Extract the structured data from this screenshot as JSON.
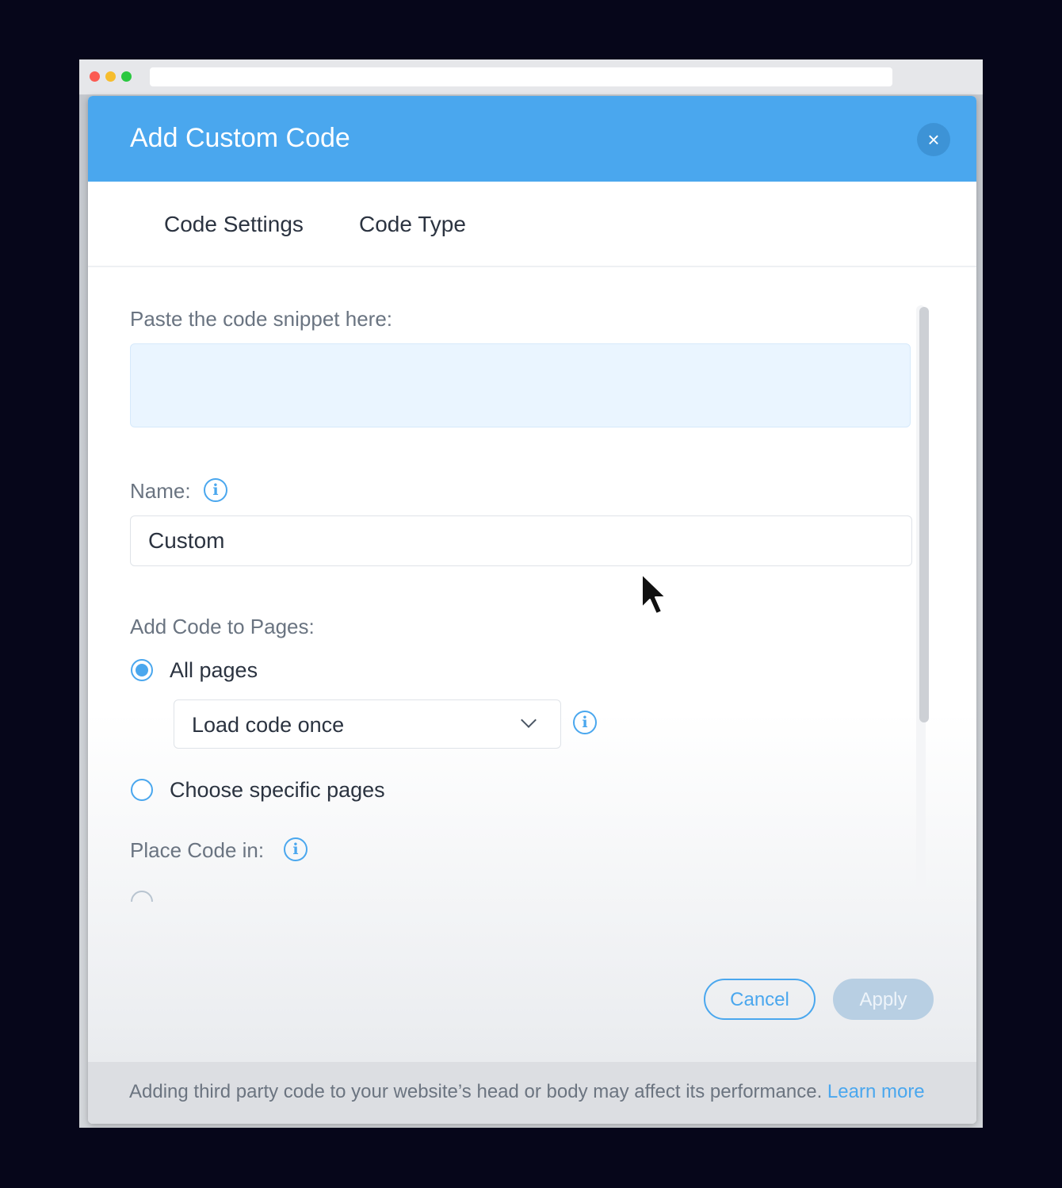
{
  "dialog": {
    "title": "Add Custom Code",
    "close_label": "×"
  },
  "tabs": [
    {
      "label": "Code Settings"
    },
    {
      "label": "Code Type"
    }
  ],
  "snippet": {
    "label": "Paste the code snippet here:",
    "value": ""
  },
  "name_field": {
    "label": "Name:",
    "value": "Custom"
  },
  "pages": {
    "label": "Add Code to Pages:",
    "options": [
      {
        "label": "All pages",
        "selected": true
      },
      {
        "label": "Choose specific pages",
        "selected": false
      }
    ],
    "load_select": {
      "value": "Load code once"
    }
  },
  "place": {
    "label": "Place Code in:"
  },
  "info_glyph": "i",
  "buttons": {
    "cancel": "Cancel",
    "apply": "Apply"
  },
  "footer": {
    "text": "Adding third party code to your website’s head or body may affect its performance. ",
    "link": "Learn more"
  },
  "colors": {
    "header": "#4aa7ee",
    "accent": "#4aa7ee",
    "apply_disabled": "#b8cfe3"
  }
}
